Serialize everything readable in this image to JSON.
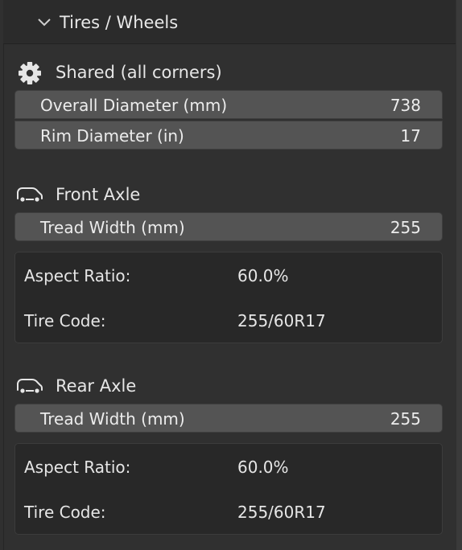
{
  "panel": {
    "title": "Tires / Wheels"
  },
  "shared": {
    "label": "Shared (all corners)",
    "icon": "gear-icon",
    "fields": [
      {
        "label": "Overall Diameter (mm)",
        "value": "738"
      },
      {
        "label": "Rim Diameter (in)",
        "value": "17"
      }
    ]
  },
  "front": {
    "label": "Front Axle",
    "icon": "car-icon",
    "tread": {
      "label": "Tread Width (mm)",
      "value": "255"
    },
    "info": {
      "aspect_label": "Aspect Ratio:",
      "aspect_value": "60.0%",
      "code_label": "Tire Code:",
      "code_value": "255/60R17"
    }
  },
  "rear": {
    "label": "Rear Axle",
    "icon": "car-icon",
    "tread": {
      "label": "Tread Width (mm)",
      "value": "255"
    },
    "info": {
      "aspect_label": "Aspect Ratio:",
      "aspect_value": "60.0%",
      "code_label": "Tire Code:",
      "code_value": "255/60R17"
    }
  }
}
